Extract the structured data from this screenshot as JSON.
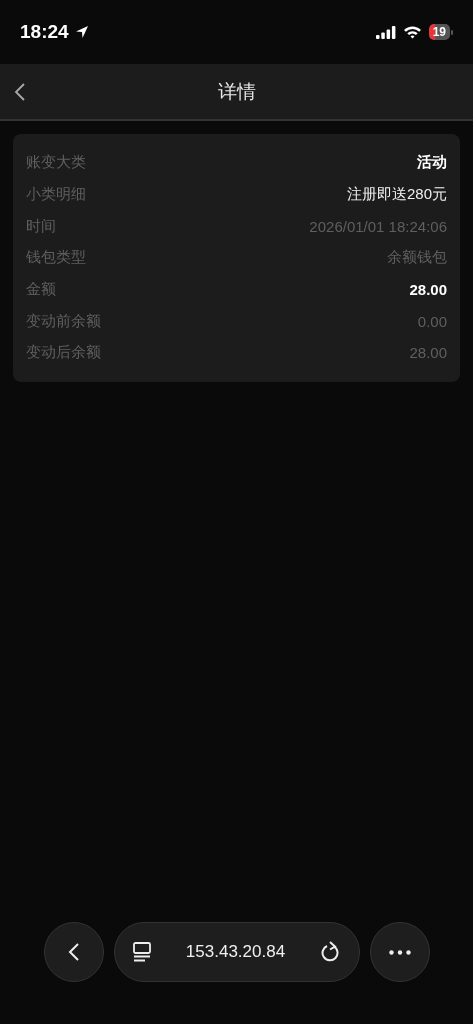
{
  "status_bar": {
    "time": "18:24",
    "battery": "19"
  },
  "nav_bar": {
    "title": "详情"
  },
  "details": [
    {
      "label": "账变大类",
      "value": "活动",
      "kind": "strong"
    },
    {
      "label": "小类明细",
      "value": "注册即送280元",
      "kind": "plain"
    },
    {
      "label": "时间",
      "value": "2026/01/01 18:24:06",
      "kind": "muted"
    },
    {
      "label": "钱包类型",
      "value": "余额钱包",
      "kind": "muted"
    },
    {
      "label": "金额",
      "value": "28.00",
      "kind": "strong"
    },
    {
      "label": "变动前余额",
      "value": "0.00",
      "kind": "muted"
    },
    {
      "label": "变动后余额",
      "value": "28.00",
      "kind": "muted"
    }
  ],
  "browser_bar": {
    "address": "153.43.20.84"
  }
}
